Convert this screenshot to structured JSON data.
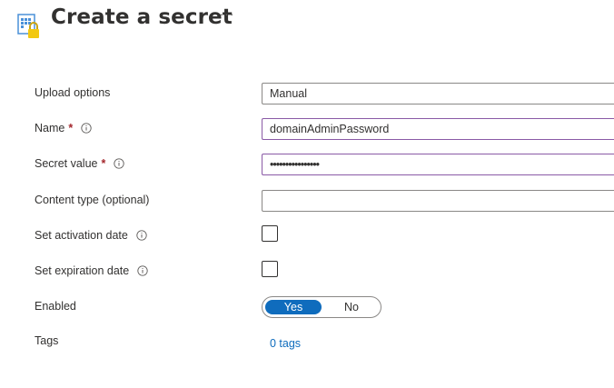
{
  "header": {
    "title": "Create a secret",
    "more_label": "···",
    "icon": "key-vault-secret-icon"
  },
  "form": {
    "upload_options": {
      "label": "Upload options",
      "value": "Manual"
    },
    "name": {
      "label": "Name",
      "required_mark": "*",
      "value": "domainAdminPassword"
    },
    "secret_value": {
      "label": "Secret value",
      "required_mark": "*",
      "value": "••••••••••••••••"
    },
    "content_type": {
      "label": "Content type (optional)",
      "value": ""
    },
    "activation_date": {
      "label": "Set activation date",
      "checked": false
    },
    "expiration_date": {
      "label": "Set expiration date",
      "checked": false
    },
    "enabled": {
      "label": "Enabled",
      "yes": "Yes",
      "no": "No",
      "selected": "Yes"
    },
    "tags": {
      "label": "Tags",
      "link": "0 tags"
    }
  },
  "colors": {
    "accent": "#0f6cbd",
    "required": "#a4262c",
    "focus_border": "#8a5aa6"
  }
}
